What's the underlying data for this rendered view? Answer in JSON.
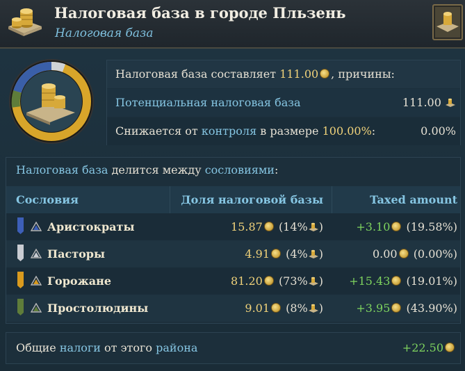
{
  "header": {
    "title": "Налоговая база в городе Пльзень",
    "subtitle": "Налоговая база"
  },
  "summary": {
    "row1_prefix": "Налоговая база составляет",
    "row1_value": "111.00",
    "row1_suffix": ", причины:",
    "row2_label": "Потенциальная налоговая база",
    "row2_value": "111.00",
    "row3_a": "Снижается от",
    "row3_link": "контроля",
    "row3_b": "в размере",
    "row3_pct": "100.00%",
    "row3_c": ":",
    "row3_value": "0.00%"
  },
  "estates_panel": {
    "title_a": "Налоговая база",
    "title_b": "делится между",
    "title_c": "сословиями",
    "title_d": ":",
    "columns": [
      "Сословия",
      "Доля налоговой базы",
      "Taxed amount"
    ],
    "rows": [
      {
        "name": "Аристократы",
        "share": "15.87",
        "share_pct": "(14%",
        "taxed": "+3.10",
        "taxed_pct": "(19.58%)",
        "taxed_positive": true,
        "color": "#3d5fb8"
      },
      {
        "name": "Пасторы",
        "share": "4.91",
        "share_pct": "(4%",
        "taxed": "0.00",
        "taxed_pct": "(0.00%)",
        "taxed_positive": false,
        "color": "#c9ccd2"
      },
      {
        "name": "Горожане",
        "share": "81.20",
        "share_pct": "(73%",
        "taxed": "+15.43",
        "taxed_pct": "(19.01%)",
        "taxed_positive": true,
        "color": "#d99a1e"
      },
      {
        "name": "Простолюдины",
        "share": "9.01",
        "share_pct": "(8%",
        "taxed": "+3.95",
        "taxed_pct": "(43.90%)",
        "taxed_positive": true,
        "color": "#5f7d3a"
      }
    ],
    "close_paren": ")"
  },
  "footer": {
    "a": "Общие",
    "link1": "налоги",
    "b": "от этого",
    "link2": "района",
    "value": "+22.50"
  },
  "colors": {
    "accent_blue": "#86c6e3",
    "positive_green": "#7ed35e",
    "highlight_yellow": "#f0d27a"
  }
}
